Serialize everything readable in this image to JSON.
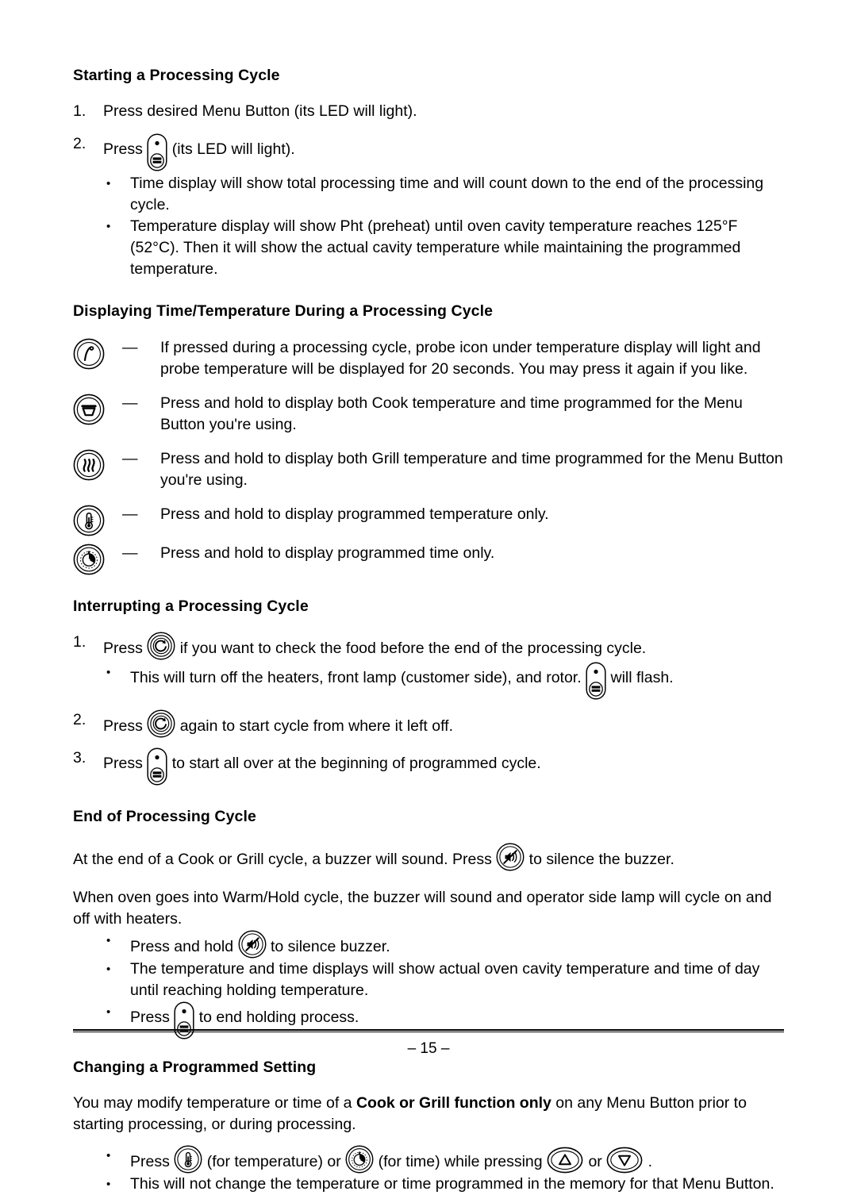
{
  "document": {
    "page_number": "– 15 –"
  },
  "sections": {
    "starting": {
      "heading": "Starting a Processing Cycle",
      "steps": [
        {
          "marker": "1.",
          "text": "Press desired Menu Button (its LED will light)."
        },
        {
          "marker": "2.",
          "text_before": "Press",
          "icon": "start-stop-button-icon",
          "text_after": "(its LED will light)."
        }
      ],
      "bullets": [
        "Time display will show total processing time and will count down to the end of the processing cycle.",
        "Temperature display will show Pht (preheat) until oven cavity temperature reaches 125°F (52°C). Then it will show the actual cavity temperature while maintaining the programmed temperature."
      ]
    },
    "displaying": {
      "heading": "Displaying Time/Temperature During a Processing Cycle",
      "dash": "—",
      "rows": [
        {
          "icon": "probe-icon",
          "text": "If pressed during a processing cycle, probe icon under temperature display will light and probe temperature will be displayed for 20 seconds. You may press it again if you like."
        },
        {
          "icon": "cook-icon",
          "text": "Press and hold  to display both Cook temperature and time programmed for the Menu Button you're using."
        },
        {
          "icon": "grill-icon",
          "text": "Press and hold to display both Grill temperature and time programmed for the Menu Button you're using."
        },
        {
          "icon": "temperature-icon",
          "text": "Press and hold to display programmed temperature only."
        },
        {
          "icon": "time-icon",
          "text": "Press and hold to display programmed time only."
        }
      ]
    },
    "interrupting": {
      "heading": "Interrupting a Processing Cycle",
      "step1": {
        "marker": "1.",
        "text_before": "Press",
        "icon": "check-food-icon",
        "text_after": "if you want to check the food before the end of the processing cycle."
      },
      "step1_bullet": {
        "text_before": "This will turn off the heaters, front lamp (customer side), and rotor.",
        "icon": "start-stop-button-icon",
        "text_after": "will flash."
      },
      "step2": {
        "marker": "2.",
        "text_before": "Press",
        "icon": "check-food-icon",
        "text_after": "again to start cycle from where it left off."
      },
      "step3": {
        "marker": "3.",
        "text_before": "Press",
        "icon": "start-stop-button-icon",
        "text_after": "to start all over at the beginning of programmed cycle."
      }
    },
    "end": {
      "heading": "End of Processing Cycle",
      "para1_before": "At the end of a Cook or Grill cycle, a buzzer will sound. Press",
      "para1_icon": "buzzer-mute-icon",
      "para1_after": "to silence the buzzer.",
      "para2": "When oven goes into Warm/Hold cycle, the buzzer will sound and operator side lamp will cycle on and off with heaters.",
      "bullets": [
        {
          "text_before": "Press and hold",
          "icon": "buzzer-mute-icon",
          "text_after": "to silence buzzer."
        },
        {
          "text_before": "The temperature and time displays will show actual oven cavity temperature and time of day until reaching holding temperature.",
          "icon": "",
          "text_after": ""
        },
        {
          "text_before": "Press",
          "icon": "start-stop-button-icon",
          "text_after": "to end holding process."
        }
      ]
    },
    "changing": {
      "heading": "Changing a Programmed Setting",
      "para_part1": "You may modify temperature or time of a ",
      "para_bold": "Cook or Grill function only",
      "para_part2": " on any Menu Button prior to starting processing, or during processing.",
      "bullet1": {
        "t1": "Press",
        "icon1": "temperature-icon",
        "t2": "(for temperature)  or",
        "icon2": "time-icon",
        "t3": "(for time) while pressing",
        "icon3": "arrow-up-icon",
        "t4": "or",
        "icon4": "arrow-down-icon",
        "t5": "."
      },
      "bullet2": "This will not change the temperature or time programmed in the memory for that Menu Button."
    }
  },
  "bullet_glyph": "•",
  "colors": {
    "ink": "#000000",
    "paper": "#ffffff"
  }
}
